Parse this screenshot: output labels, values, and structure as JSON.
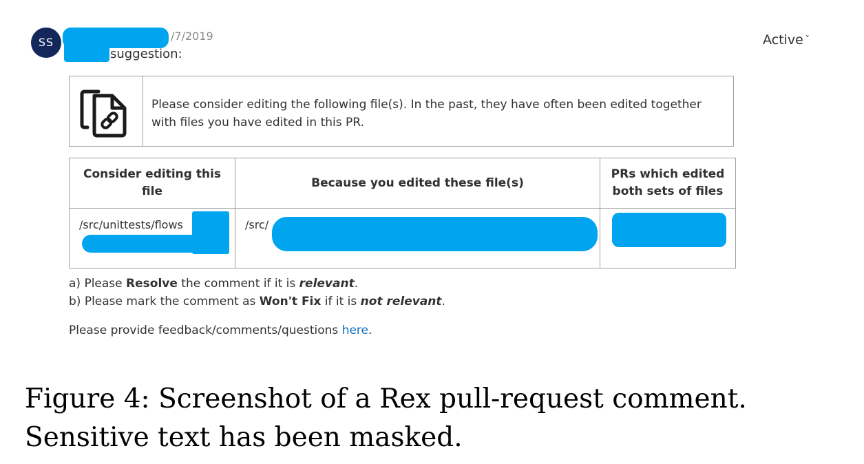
{
  "comment": {
    "avatar_initials": "SS",
    "date_suffix": "/7/2019",
    "headline_suffix": "suggestion:",
    "status": "Active",
    "status_chevron": "˅"
  },
  "info": {
    "icon": "linked-files-icon",
    "text": "Please consider editing the following file(s). In the past, they have often been edited together with files you have edited in this PR."
  },
  "table": {
    "headers": [
      "Consider editing this file",
      "Because you edited these file(s)",
      "PRs which edited both sets of files"
    ],
    "rows": [
      {
        "file": "/src/unittests/flows",
        "edited": "/src/",
        "prs": ""
      }
    ]
  },
  "instructions": {
    "a_prefix": "a) Please ",
    "a_bold": "Resolve",
    "a_mid": " the comment if it is ",
    "a_em": "relevant",
    "a_end": ".",
    "b_prefix": "b) Please mark the comment as ",
    "b_bold": "Won't Fix",
    "b_mid": " if it is ",
    "b_em": "not relevant",
    "b_end": "."
  },
  "feedback": {
    "text": "Please provide feedback/comments/questions ",
    "link": "here",
    "end": "."
  },
  "caption": "Figure 4: Screenshot of a Rex pull-request comment. Sensitive text has been masked.",
  "colors": {
    "mask": "#00a4ef",
    "avatar_bg": "#13275a",
    "link": "#0f6cbd",
    "border": "#a19f9d"
  }
}
